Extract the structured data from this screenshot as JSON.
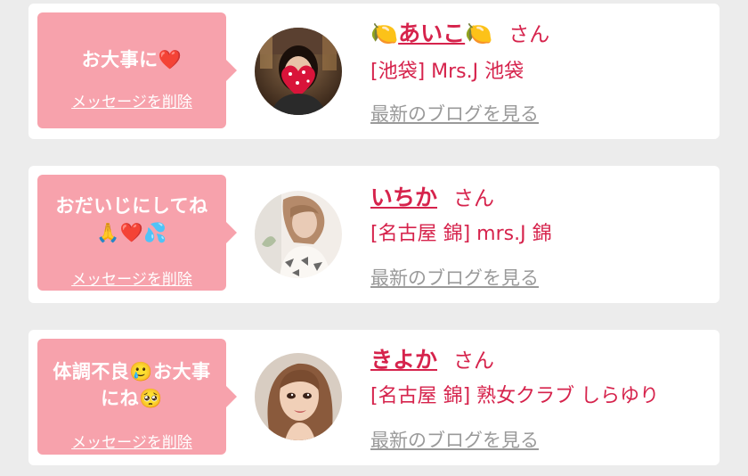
{
  "messages": [
    {
      "message_line1": "お大事に❤️",
      "message_line2": "",
      "delete_label": "メッセージを削除",
      "name_prefix": "🍋",
      "name": "あいこ",
      "name_suffix": "🍋",
      "honorific": "さん",
      "shop": "[池袋] Mrs.J 池袋",
      "blog_link": "最新のブログを見る"
    },
    {
      "message_line1": "おだいじにしてね",
      "message_line2": "🙏❤️💦",
      "delete_label": "メッセージを削除",
      "name_prefix": "",
      "name": "いちか",
      "name_suffix": "",
      "honorific": "さん",
      "shop": "[名古屋 錦] mrs.J 錦",
      "blog_link": "最新のブログを見る"
    },
    {
      "message_line1": "体調不良🥲お大事",
      "message_line2": "にね🥺",
      "delete_label": "メッセージを削除",
      "name_prefix": "",
      "name": "きよか",
      "name_suffix": "",
      "honorific": "さん",
      "shop": "[名古屋 錦] 熟女クラブ しらゆり",
      "blog_link": "最新のブログを見る"
    }
  ],
  "colors": {
    "bubble": "#f7a2ac",
    "name": "#d6234c",
    "blog_link": "#9a9a9a",
    "background": "#ececec"
  }
}
